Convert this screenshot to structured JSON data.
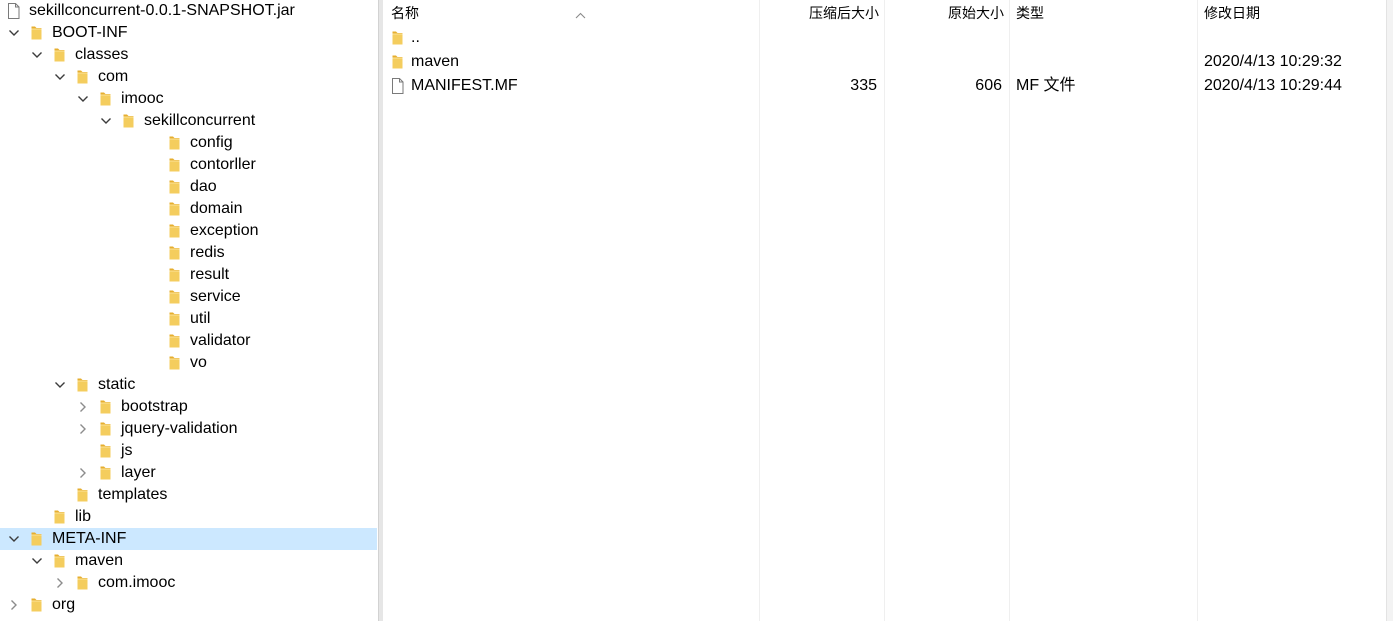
{
  "colors": {
    "selection": "#cce8ff",
    "folder": "#f4cd5e",
    "folder_dark": "#e6ae2e"
  },
  "tree": {
    "items": [
      {
        "label": "sekillconcurrent-0.0.1-SNAPSHOT.jar",
        "icon": "file-icon",
        "expander": "none"
      },
      {
        "label": "BOOT-INF",
        "icon": "folder-icon",
        "expander": "expanded"
      },
      {
        "label": "classes",
        "icon": "folder-icon",
        "expander": "expanded"
      },
      {
        "label": "com",
        "icon": "folder-icon",
        "expander": "expanded"
      },
      {
        "label": "imooc",
        "icon": "folder-icon",
        "expander": "expanded"
      },
      {
        "label": "sekillconcurrent",
        "icon": "folder-icon",
        "expander": "expanded"
      },
      {
        "label": "config",
        "icon": "folder-icon",
        "expander": "none"
      },
      {
        "label": "contorller",
        "icon": "folder-icon",
        "expander": "none"
      },
      {
        "label": "dao",
        "icon": "folder-icon",
        "expander": "none"
      },
      {
        "label": "domain",
        "icon": "folder-icon",
        "expander": "none"
      },
      {
        "label": "exception",
        "icon": "folder-icon",
        "expander": "none"
      },
      {
        "label": "redis",
        "icon": "folder-icon",
        "expander": "none"
      },
      {
        "label": "result",
        "icon": "folder-icon",
        "expander": "none"
      },
      {
        "label": "service",
        "icon": "folder-icon",
        "expander": "none"
      },
      {
        "label": "util",
        "icon": "folder-icon",
        "expander": "none"
      },
      {
        "label": "validator",
        "icon": "folder-icon",
        "expander": "none"
      },
      {
        "label": "vo",
        "icon": "folder-icon",
        "expander": "none"
      },
      {
        "label": "static",
        "icon": "folder-icon",
        "expander": "expanded"
      },
      {
        "label": "bootstrap",
        "icon": "folder-icon",
        "expander": "collapsed"
      },
      {
        "label": "jquery-validation",
        "icon": "folder-icon",
        "expander": "collapsed"
      },
      {
        "label": "js",
        "icon": "folder-icon",
        "expander": "none"
      },
      {
        "label": "layer",
        "icon": "folder-icon",
        "expander": "collapsed"
      },
      {
        "label": "templates",
        "icon": "folder-icon",
        "expander": "none"
      },
      {
        "label": "lib",
        "icon": "folder-icon",
        "expander": "none"
      },
      {
        "label": "META-INF",
        "icon": "folder-icon",
        "expander": "expanded",
        "selected": true
      },
      {
        "label": "maven",
        "icon": "folder-icon",
        "expander": "expanded"
      },
      {
        "label": "com.imooc",
        "icon": "folder-icon",
        "expander": "collapsed"
      },
      {
        "label": "org",
        "icon": "folder-icon",
        "expander": "collapsed"
      }
    ]
  },
  "list": {
    "columns": {
      "name": "名称",
      "compressed": "压缩后大小",
      "original": "原始大小",
      "type": "类型",
      "modified": "修改日期"
    },
    "sort_icon": "sort-up-icon",
    "rows": [
      {
        "name": "..",
        "icon": "folder-icon",
        "compressed": "",
        "original": "",
        "type": "",
        "modified": ""
      },
      {
        "name": "maven",
        "icon": "folder-icon",
        "compressed": "",
        "original": "",
        "type": "",
        "modified": "2020/4/13 10:29:32"
      },
      {
        "name": "MANIFEST.MF",
        "icon": "file-icon",
        "compressed": "335",
        "original": "606",
        "type": "MF 文件",
        "modified": "2020/4/13 10:29:44"
      }
    ]
  }
}
